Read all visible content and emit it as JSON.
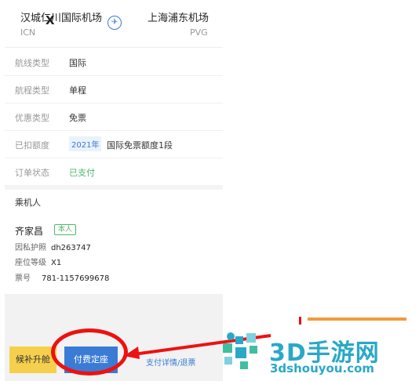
{
  "route": {
    "from_city": "汉城仁川国际机场",
    "from_code": "ICN",
    "to_city": "上海浦东机场",
    "to_code": "PVG",
    "x_mark": "X"
  },
  "details": [
    {
      "label": "航线类型",
      "value": "国际"
    },
    {
      "label": "航程类型",
      "value": "单程"
    },
    {
      "label": "优惠类型",
      "value": "免票"
    },
    {
      "label": "已扣额度",
      "tag": "2021年",
      "value": "国际免票额度1段"
    },
    {
      "label": "订单状态",
      "value": "已支付"
    }
  ],
  "passenger": {
    "section_title": "乘机人",
    "name": "齐家昌",
    "badge": "本人",
    "passport_label": "因私护照",
    "passport_value": "dh263747",
    "seat_label": "座位等级",
    "seat_value": "X1",
    "ticket_label": "票号",
    "ticket_value": "781-1157699678"
  },
  "actions": {
    "upgrade_label": "候补升舱",
    "paid_seat_label": "付费定座",
    "payment_link": "支付详情/退票"
  },
  "watermark": {
    "big": "3D手游网",
    "small": "3dshouyou.com"
  },
  "colors": {
    "accent_blue": "#3a7bd5",
    "paid_green": "#4cb86b",
    "upgrade_yellow": "#f6d04d",
    "annotation_red": "#e11111",
    "watermark_teal": "#2aa8c8"
  }
}
